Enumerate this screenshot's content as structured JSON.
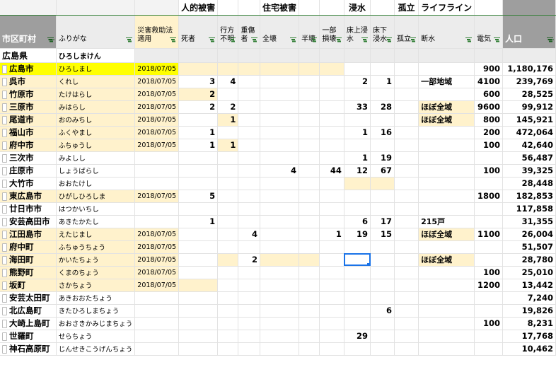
{
  "groups": [
    "",
    "",
    "",
    "人的被害",
    "",
    "",
    "住宅被害",
    "",
    "",
    "浸水",
    "",
    "孤立",
    "ライフライン",
    "",
    ""
  ],
  "headers": [
    "市区町村",
    "ふりがな",
    "災害救助法\n適用",
    "死者",
    "行方\n不明",
    "重傷者",
    "全壊",
    "半壊",
    "一部損壊",
    "床上浸水",
    "床下浸水",
    "孤立",
    "断水",
    "電気",
    "人口"
  ],
  "prefecture": {
    "name": "広島県",
    "kana": "ひろしまけん"
  },
  "rows": [
    {
      "city": "広島市",
      "kana": "ひろしまし",
      "date": "2018/07/05",
      "cells": [
        "",
        "",
        "",
        "",
        "",
        "",
        "",
        "",
        "",
        "",
        "900",
        "1,180,176"
      ]
    },
    {
      "city": "呉市",
      "kana": "くれし",
      "date": "2018/07/05",
      "cells": [
        "3",
        "4",
        "",
        "",
        "",
        "",
        "2",
        "1",
        "",
        "一部地域",
        "4100",
        "239,769"
      ]
    },
    {
      "city": "竹原市",
      "kana": "たけはらし",
      "date": "2018/07/05",
      "cells": [
        "2",
        "",
        "",
        "",
        "",
        "",
        "",
        "",
        "",
        "",
        "600",
        "28,525"
      ]
    },
    {
      "city": "三原市",
      "kana": "みはらし",
      "date": "2018/07/05",
      "cells": [
        "2",
        "2",
        "",
        "",
        "",
        "",
        "33",
        "28",
        "",
        "ほぼ全域",
        "9600",
        "99,912"
      ]
    },
    {
      "city": "尾道市",
      "kana": "おのみちし",
      "date": "2018/07/05",
      "cells": [
        "",
        "1",
        "",
        "",
        "",
        "",
        "",
        "",
        "",
        "ほぼ全域",
        "800",
        "145,921"
      ]
    },
    {
      "city": "福山市",
      "kana": "ふくやまし",
      "date": "2018/07/05",
      "cells": [
        "1",
        "",
        "",
        "",
        "",
        "",
        "1",
        "16",
        "",
        "",
        "200",
        "472,064"
      ]
    },
    {
      "city": "府中市",
      "kana": "ふちゅうし",
      "date": "2018/07/05",
      "cells": [
        "1",
        "1",
        "",
        "",
        "",
        "",
        "",
        "",
        "",
        "",
        "100",
        "42,640"
      ]
    },
    {
      "city": "三次市",
      "kana": "みよしし",
      "date": "",
      "cells": [
        "",
        "",
        "",
        "",
        "",
        "",
        "1",
        "19",
        "",
        "",
        "",
        "56,487"
      ]
    },
    {
      "city": "庄原市",
      "kana": "しょうばらし",
      "date": "",
      "cells": [
        "",
        "",
        "",
        "4",
        "",
        "44",
        "12",
        "67",
        "",
        "",
        "100",
        "39,325"
      ]
    },
    {
      "city": "大竹市",
      "kana": "おおたけし",
      "date": "",
      "cells": [
        "",
        "",
        "",
        "",
        "",
        "",
        "",
        "",
        "",
        "",
        "",
        "28,448"
      ]
    },
    {
      "city": "東広島市",
      "kana": "ひがしひろしま",
      "date": "2018/07/05",
      "cells": [
        "5",
        "",
        "",
        "",
        "",
        "",
        "",
        "",
        "",
        "",
        "1800",
        "182,853"
      ]
    },
    {
      "city": "廿日市市",
      "kana": "はつかいちし",
      "date": "",
      "cells": [
        "",
        "",
        "",
        "",
        "",
        "",
        "",
        "",
        "",
        "",
        "",
        "117,858"
      ]
    },
    {
      "city": "安芸高田市",
      "kana": "あきたかたし",
      "date": "",
      "cells": [
        "1",
        "",
        "",
        "",
        "",
        "",
        "6",
        "17",
        "",
        "215戸",
        "",
        "31,355"
      ]
    },
    {
      "city": "江田島市",
      "kana": "えたじまし",
      "date": "2018/07/05",
      "cells": [
        "",
        "",
        "4",
        "",
        "",
        "1",
        "19",
        "15",
        "",
        "ほぼ全域",
        "1100",
        "26,004"
      ]
    },
    {
      "city": "府中町",
      "kana": "ふちゅうちょう",
      "date": "2018/07/05",
      "cells": [
        "",
        "",
        "",
        "",
        "",
        "",
        "",
        "",
        "",
        "",
        "",
        "51,507"
      ]
    },
    {
      "city": "海田町",
      "kana": "かいたちょう",
      "date": "2018/07/05",
      "cells": [
        "",
        "",
        "2",
        "",
        "",
        "",
        "",
        "",
        "",
        "ほぼ全域",
        "",
        "28,780"
      ]
    },
    {
      "city": "熊野町",
      "kana": "くまのちょう",
      "date": "2018/07/05",
      "cells": [
        "",
        "",
        "",
        "",
        "",
        "",
        "",
        "",
        "",
        "",
        "100",
        "25,010"
      ]
    },
    {
      "city": "坂町",
      "kana": "さかちょう",
      "date": "2018/07/05",
      "cells": [
        "",
        "",
        "",
        "",
        "",
        "",
        "",
        "",
        "",
        "",
        "1200",
        "13,442"
      ]
    },
    {
      "city": "安芸太田町",
      "kana": "あきおおたちょう",
      "date": "",
      "cells": [
        "",
        "",
        "",
        "",
        "",
        "",
        "",
        "",
        "",
        "",
        "",
        "7,240"
      ]
    },
    {
      "city": "北広島町",
      "kana": "きたひろしまちょう",
      "date": "",
      "cells": [
        "",
        "",
        "",
        "",
        "",
        "",
        "",
        "6",
        "",
        "",
        "",
        "19,826"
      ]
    },
    {
      "city": "大崎上島町",
      "kana": "おおさきかみじまちょう",
      "date": "",
      "cells": [
        "",
        "",
        "",
        "",
        "",
        "",
        "",
        "",
        "",
        "",
        "100",
        "8,231"
      ]
    },
    {
      "city": "世羅町",
      "kana": "せらちょう",
      "date": "",
      "cells": [
        "",
        "",
        "",
        "",
        "",
        "",
        "29",
        "",
        "",
        "",
        "",
        "17,768"
      ]
    },
    {
      "city": "神石高原町",
      "kana": "じんせきこうげんちょう",
      "date": "",
      "cells": [
        "",
        "",
        "",
        "",
        "",
        "",
        "",
        "",
        "",
        "",
        "",
        "10,462"
      ]
    }
  ],
  "colors": {
    "highlight_yellow": "#ffff00",
    "light_yellow": "#fff2cc",
    "header_gray": "#9e9e9e",
    "filter_green": "#2e7d32",
    "selection_blue": "#1a73e8"
  },
  "icons": {
    "filter": "filter-icon",
    "row_marker": "row-marker-icon"
  }
}
